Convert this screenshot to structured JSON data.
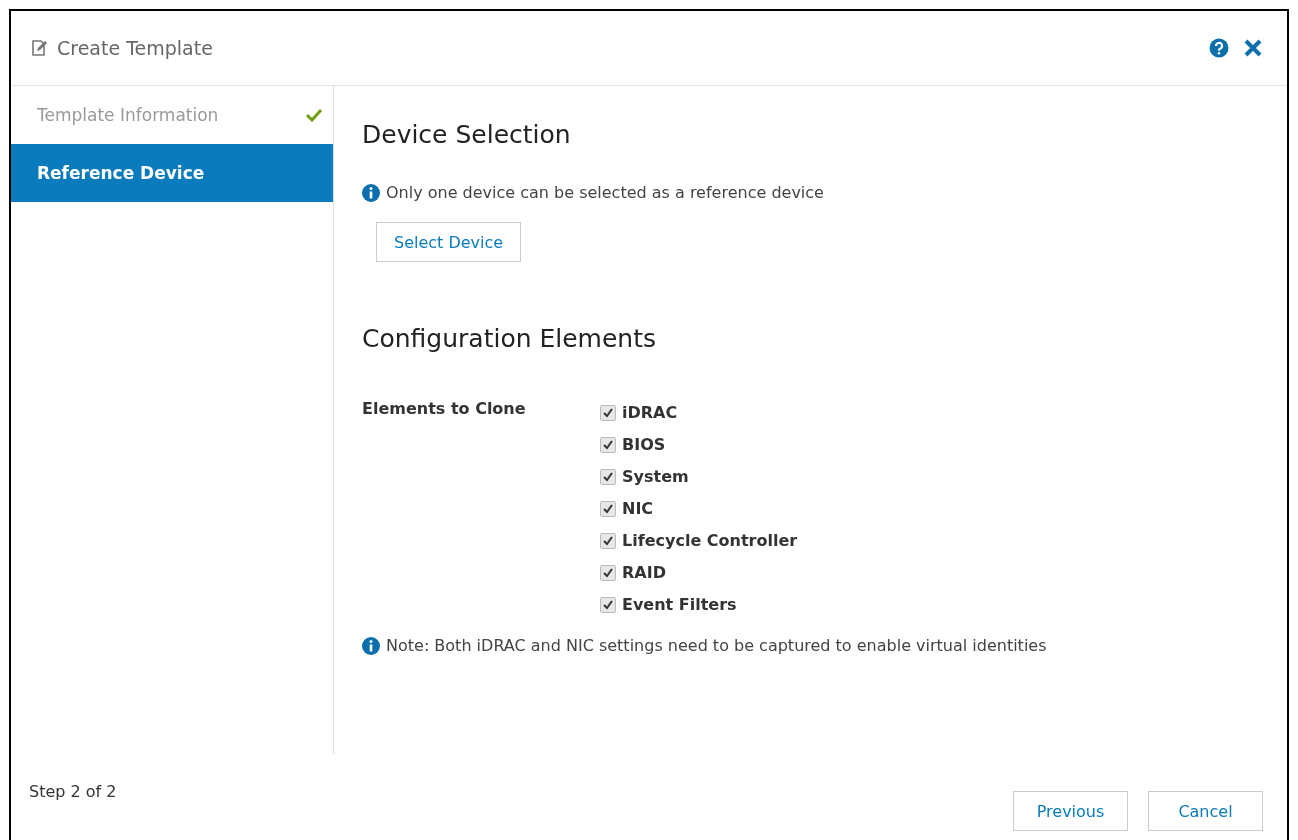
{
  "window": {
    "title": "Create Template"
  },
  "steps": [
    {
      "label": "Template Information",
      "selected": false,
      "completed": true
    },
    {
      "label": "Reference Device",
      "selected": true,
      "completed": false
    }
  ],
  "device_selection": {
    "heading": "Device Selection",
    "info": "Only one device can be selected as a reference device",
    "button": "Select Device"
  },
  "configuration": {
    "heading": "Configuration Elements",
    "label": "Elements to Clone",
    "elements": [
      {
        "label": "iDRAC",
        "checked": true
      },
      {
        "label": "BIOS",
        "checked": true
      },
      {
        "label": "System",
        "checked": true
      },
      {
        "label": "NIC",
        "checked": true
      },
      {
        "label": "Lifecycle Controller",
        "checked": true
      },
      {
        "label": "RAID",
        "checked": true
      },
      {
        "label": "Event Filters",
        "checked": true
      }
    ],
    "note": "Note: Both iDRAC and NIC settings need to be captured to enable virtual identities"
  },
  "footer": {
    "step": "Step 2 of 2",
    "buttons": [
      "Previous",
      "Cancel"
    ]
  }
}
